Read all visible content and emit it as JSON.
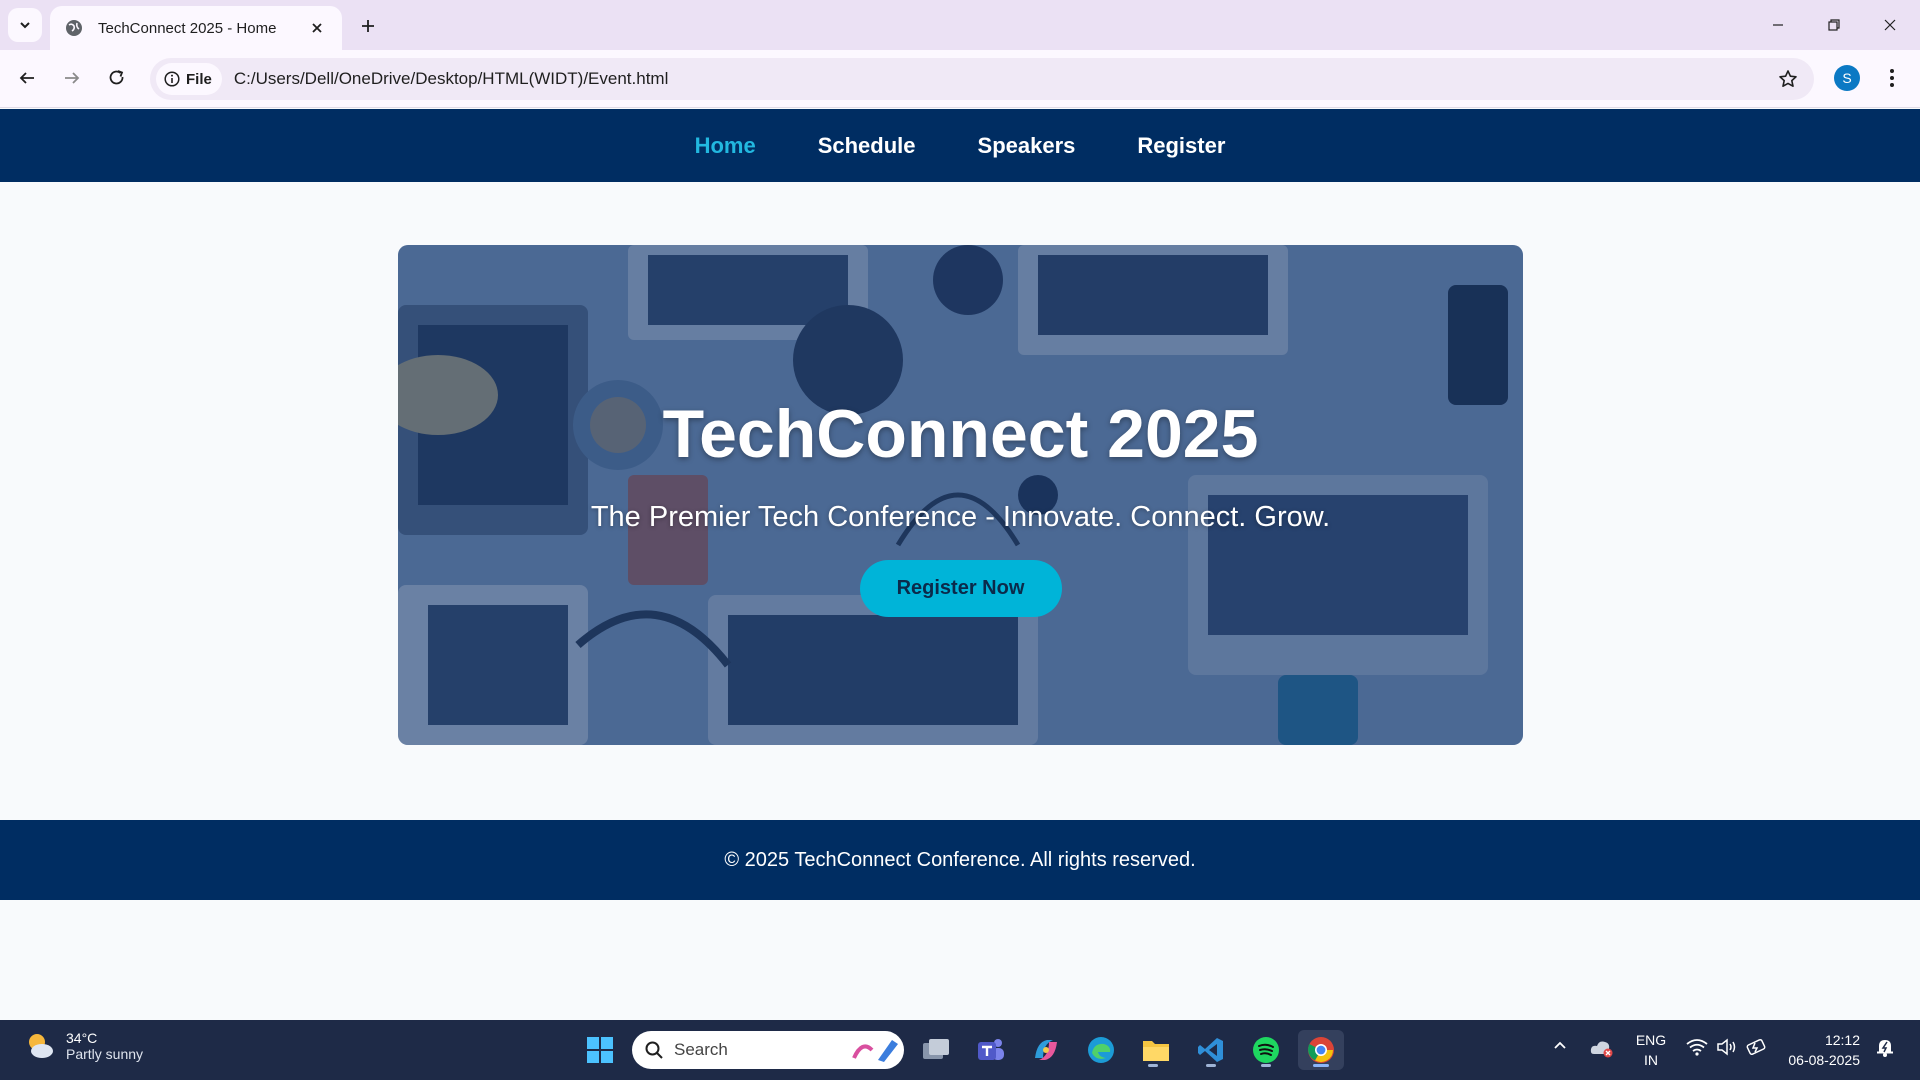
{
  "browser": {
    "tab_title": "TechConnect 2025 - Home",
    "chip_label": "File",
    "url": "C:/Users/Dell/OneDrive/Desktop/HTML(WIDT)/Event.html",
    "profile_initial": "S",
    "icons": {
      "tab_search": "chevron-down-icon",
      "favicon": "globe-icon",
      "tab_close": "close-icon",
      "new_tab": "plus-icon",
      "back": "back-arrow-icon",
      "forward": "forward-arrow-icon",
      "reload": "reload-icon",
      "info": "info-icon",
      "bookmark": "star-icon",
      "menu": "kebab-menu-icon",
      "minimize": "minimize-icon",
      "restore": "restore-icon",
      "close": "close-icon"
    }
  },
  "site": {
    "nav": [
      {
        "label": "Home",
        "active": true
      },
      {
        "label": "Schedule",
        "active": false
      },
      {
        "label": "Speakers",
        "active": false
      },
      {
        "label": "Register",
        "active": false
      }
    ],
    "hero": {
      "title": "TechConnect 2025",
      "subtitle": "The Premier Tech Conference - Innovate. Connect. Grow.",
      "cta_label": "Register Now"
    },
    "footer": {
      "text": "© 2025 TechConnect Conference. All rights reserved."
    },
    "colors": {
      "nav_bg": "#002d62",
      "active_link": "#22b8e0",
      "cta_bg": "#00b4d8",
      "page_bg": "#f8fafc"
    }
  },
  "taskbar": {
    "weather": {
      "temp": "34°C",
      "condition": "Partly sunny",
      "icon": "partly-sunny-icon"
    },
    "search_placeholder": "Search",
    "apps": [
      "windows-start-icon",
      "task-view-icon",
      "teams-icon",
      "copilot-icon",
      "edge-icon",
      "file-explorer-icon",
      "vscode-icon",
      "spotify-icon",
      "chrome-icon"
    ],
    "tray": {
      "lang_top": "ENG",
      "lang_bottom": "IN",
      "time": "12:12",
      "date": "06-08-2025"
    }
  }
}
